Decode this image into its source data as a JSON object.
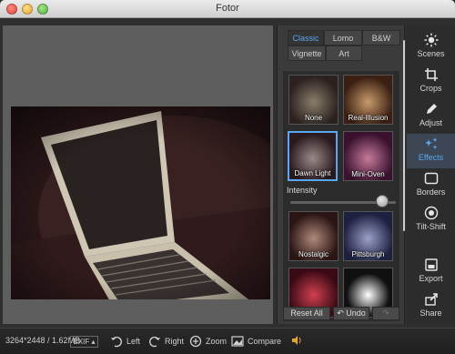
{
  "window": {
    "title": "Fotor"
  },
  "panel": {
    "tabs": [
      {
        "label": "Classic",
        "active": true
      },
      {
        "label": "Lomo",
        "active": false
      },
      {
        "label": "B&W",
        "active": false
      },
      {
        "label": "Vignette",
        "active": false
      },
      {
        "label": "Art",
        "active": false
      }
    ],
    "effects": [
      {
        "label": "None",
        "selected": false
      },
      {
        "label": "Real-Illusion",
        "selected": false
      },
      {
        "label": "Dawn Light",
        "selected": true
      },
      {
        "label": "Mini-Oven",
        "selected": false
      },
      {
        "label": "Nostalgic",
        "selected": false
      },
      {
        "label": "Pittsburgh",
        "selected": false
      },
      {
        "label": "",
        "selected": false
      },
      {
        "label": "",
        "selected": false
      }
    ],
    "intensity_label": "Intensity",
    "intensity_value": 0.9,
    "reset_label": "Reset All",
    "undo_label": "Undo",
    "redo_label": ""
  },
  "tools": [
    {
      "label": "Scenes",
      "icon": "sun-icon",
      "active": false
    },
    {
      "label": "Crops",
      "icon": "crop-icon",
      "active": false
    },
    {
      "label": "Adjust",
      "icon": "pencil-icon",
      "active": false
    },
    {
      "label": "Effects",
      "icon": "sparkle-icon",
      "active": true
    },
    {
      "label": "Borders",
      "icon": "frame-icon",
      "active": false
    },
    {
      "label": "Tilt-Shift",
      "icon": "target-icon",
      "active": false
    },
    {
      "label": "Export",
      "icon": "export-icon",
      "active": false
    },
    {
      "label": "Share",
      "icon": "share-icon",
      "active": false
    }
  ],
  "status": {
    "image_info": "3264*2448 / 1.62MB",
    "exif_label": "EXIF",
    "rotate_left_label": "Left",
    "rotate_right_label": "Right",
    "zoom_label": "Zoom",
    "compare_label": "Compare"
  },
  "colors": {
    "accent": "#5aa8f0",
    "panel_bg": "#3b3b3b",
    "toolbar_bg": "#2c2c2c"
  }
}
